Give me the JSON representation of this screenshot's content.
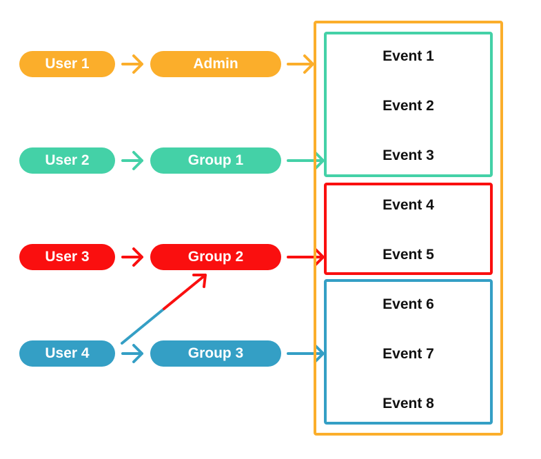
{
  "colors": {
    "orange": "#FBAE2B",
    "teal": "#44D1A7",
    "red": "#FA0F0F",
    "blue": "#349FC5"
  },
  "users": [
    {
      "label": "User 1",
      "color": "orange"
    },
    {
      "label": "User 2",
      "color": "teal"
    },
    {
      "label": "User 3",
      "color": "red"
    },
    {
      "label": "User 4",
      "color": "blue"
    }
  ],
  "groups": [
    {
      "label": "Admin",
      "color": "orange"
    },
    {
      "label": "Group 1",
      "color": "teal"
    },
    {
      "label": "Group 2",
      "color": "red"
    },
    {
      "label": "Group 3",
      "color": "blue"
    }
  ],
  "event_groups": [
    {
      "color": "teal",
      "events": [
        "Event 1",
        "Event 2",
        "Event 3"
      ]
    },
    {
      "color": "red",
      "events": [
        "Event 4",
        "Event 5"
      ]
    },
    {
      "color": "blue",
      "events": [
        "Event 6",
        "Event 7",
        "Event 8"
      ]
    }
  ],
  "edges": [
    {
      "from": "User 1",
      "to": "Admin"
    },
    {
      "from": "User 2",
      "to": "Group 1"
    },
    {
      "from": "User 3",
      "to": "Group 2"
    },
    {
      "from": "User 4",
      "to": "Group 2"
    },
    {
      "from": "User 4",
      "to": "Group 3"
    },
    {
      "from": "Admin",
      "to": "All Events"
    },
    {
      "from": "Group 1",
      "to": "Event 1-3"
    },
    {
      "from": "Group 2",
      "to": "Event 4-5"
    },
    {
      "from": "Group 3",
      "to": "Event 6-8"
    }
  ]
}
